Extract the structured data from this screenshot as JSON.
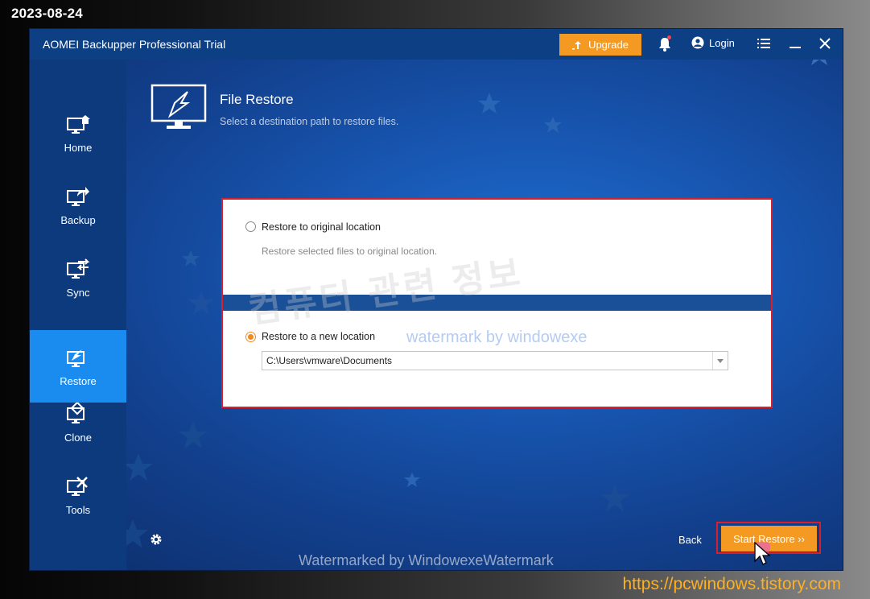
{
  "date_stamp": "2023-08-24",
  "site_url": "https://pcwindows.tistory.com",
  "window": {
    "title": "AOMEI Backupper Professional Trial",
    "upgrade_label": "Upgrade",
    "login_label": "Login"
  },
  "sidebar": {
    "items": [
      {
        "label": "Home",
        "icon": "home-icon"
      },
      {
        "label": "Backup",
        "icon": "backup-icon"
      },
      {
        "label": "Sync",
        "icon": "sync-icon"
      },
      {
        "label": "Restore",
        "icon": "restore-icon",
        "active": true
      },
      {
        "label": "Clone",
        "icon": "clone-icon"
      },
      {
        "label": "Tools",
        "icon": "tools-icon"
      }
    ]
  },
  "header": {
    "title": "File Restore",
    "subtitle": "Select a destination path to restore files."
  },
  "options": {
    "original": {
      "label": "Restore to original location",
      "description": "Restore selected files to original location.",
      "checked": false
    },
    "new_location": {
      "label": "Restore to a new location",
      "path": "C:\\Users\\vmware\\Documents",
      "checked": true
    }
  },
  "watermarks": {
    "korean": "컴퓨터 관련 정보",
    "line1": "watermark by windowexe",
    "line2": "Watermarked by WindowexeWatermark"
  },
  "footer": {
    "back_label": "Back",
    "start_label": "Start Restore ››"
  },
  "colors": {
    "accent": "#f49a22",
    "active_nav": "#1a8cf0",
    "highlight": "#d9202a"
  }
}
